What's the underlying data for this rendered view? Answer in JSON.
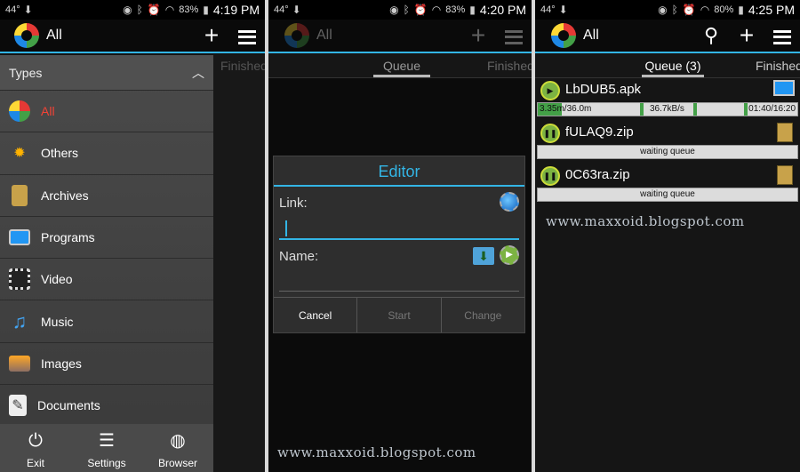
{
  "panels": [
    {
      "status": {
        "temp": "44°",
        "battery": "83%",
        "time": "4:19 PM"
      }
    },
    {
      "status": {
        "temp": "44°",
        "battery": "83%",
        "time": "4:20 PM"
      }
    },
    {
      "status": {
        "temp": "44°",
        "battery": "80%",
        "time": "4:25 PM"
      }
    }
  ],
  "appbar": {
    "title": "All"
  },
  "drawer": {
    "header": "Types",
    "items": [
      {
        "label": "All",
        "icon": "all-types-icon"
      },
      {
        "label": "Others",
        "icon": "others-icon"
      },
      {
        "label": "Archives",
        "icon": "archive-icon"
      },
      {
        "label": "Programs",
        "icon": "monitor-icon"
      },
      {
        "label": "Video",
        "icon": "film-icon"
      },
      {
        "label": "Music",
        "icon": "music-note-icon"
      },
      {
        "label": "Images",
        "icon": "image-icon"
      },
      {
        "label": "Documents",
        "icon": "document-icon"
      }
    ],
    "bottom": [
      {
        "label": "Exit",
        "icon": "power-icon"
      },
      {
        "label": "Settings",
        "icon": "sliders-icon"
      },
      {
        "label": "Browser",
        "icon": "globe-icon"
      }
    ],
    "behind_tab": "Finished"
  },
  "tabs2": {
    "queue": "Queue",
    "finished": "Finished"
  },
  "editor": {
    "title": "Editor",
    "link_label": "Link:",
    "link_value": "",
    "name_label": "Name:",
    "name_value": "",
    "buttons": {
      "cancel": "Cancel",
      "start": "Start",
      "change": "Change"
    }
  },
  "tabs3": {
    "queue": "Queue (3)",
    "finished": "Finished"
  },
  "queue": [
    {
      "name": "LbDUB5.apk",
      "downloaded": "3.35m/36.0m",
      "speed": "36.7kB/s",
      "time": "01:40/16:20",
      "progress": 0.093,
      "state": "downloading"
    },
    {
      "name": "fULAQ9.zip",
      "status": "waiting queue",
      "state": "paused"
    },
    {
      "name": "0C63ra.zip",
      "status": "waiting queue",
      "state": "paused"
    }
  ],
  "watermark": "www.maxxoid.blogspot.com",
  "colors": {
    "accent": "#33b5e5",
    "active_item": "#f44336",
    "progress": "#43a047"
  }
}
